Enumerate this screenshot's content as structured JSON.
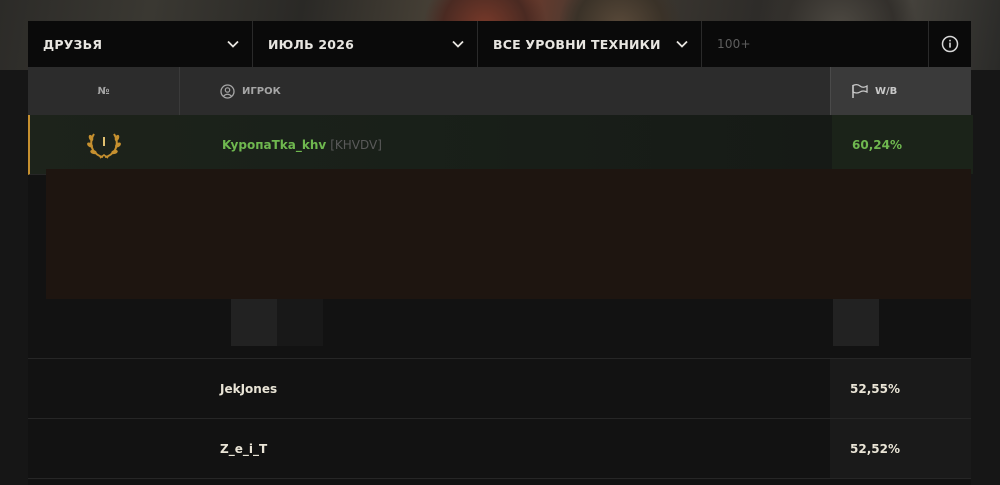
{
  "filters": {
    "scope": "ДРУЗЬЯ",
    "period": "ИЮЛЬ 2026",
    "tier": "ВСЕ УРОВНИ ТЕХНИКИ",
    "search_placeholder": "100+"
  },
  "table": {
    "headers": {
      "rank": "№",
      "player": "ИГРОК",
      "winrate": "W/B"
    },
    "rows": [
      {
        "name": "KypoпaTka_khv",
        "clan": "[KHVDV]",
        "winrate": "60,24%"
      },
      {
        "name": "JekJones",
        "winrate": "52,55%"
      },
      {
        "name": "Z_e_i_T",
        "winrate": "52,52%"
      }
    ]
  },
  "colors": {
    "highlight_green": "#6fb84f",
    "gold": "#c6902f",
    "rust_overlay": "#1e1510"
  },
  "icons": {
    "dropdown": "chevron-down-icon",
    "info": "info-icon",
    "player": "user-circle-icon",
    "winrate": "flag-icon",
    "rank": "laurel-icon"
  }
}
